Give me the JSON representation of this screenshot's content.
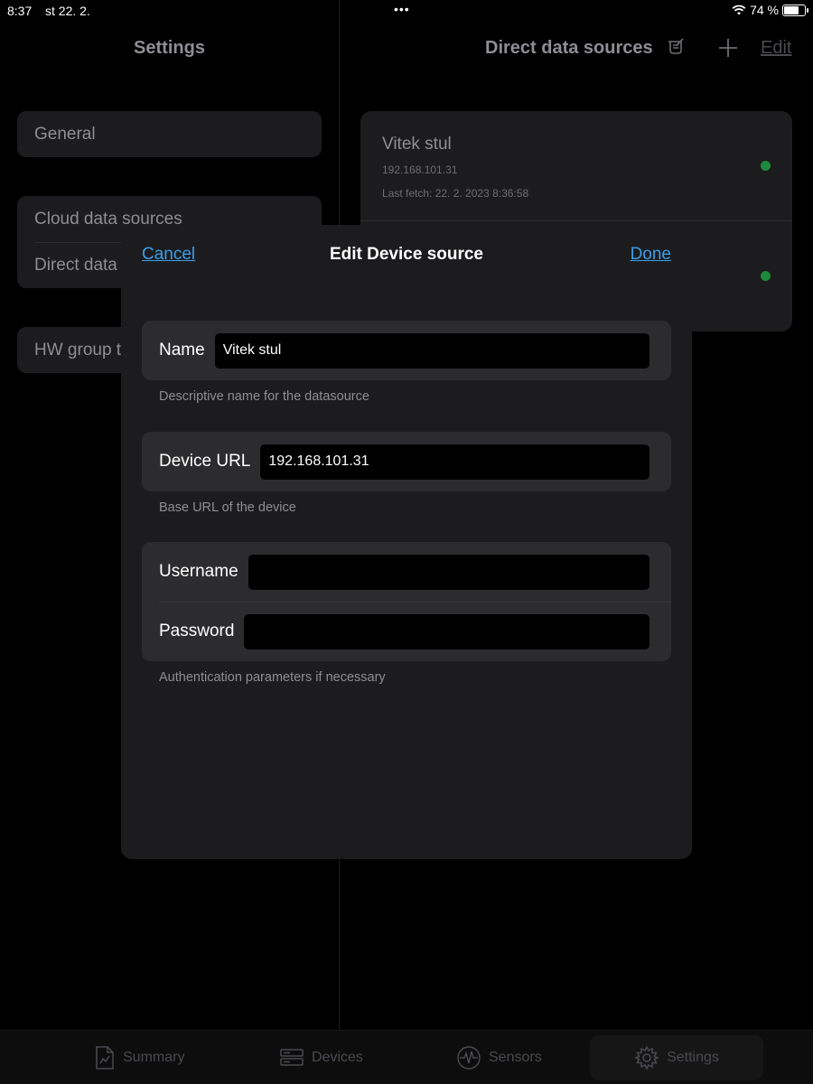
{
  "status_bar": {
    "time": "8:37",
    "date": "st 22. 2.",
    "dots": "•••",
    "battery": "74 %",
    "battery_level": 0.74
  },
  "left_panel": {
    "title": "Settings",
    "groups": [
      [
        "General"
      ],
      [
        "Cloud data sources",
        "Direct data"
      ],
      [
        "HW group t"
      ]
    ]
  },
  "right_panel": {
    "title": "Direct data sources",
    "icons": [
      "broom-icon",
      "plus-icon"
    ],
    "edit_label": "Edit",
    "sources": [
      {
        "name": "Vitek stul",
        "ip": "192.168.101.31",
        "last_fetch": "Last fetch:   22. 2. 2023 8:36:58",
        "status_color": "#1e8a3c"
      },
      {
        "name": "",
        "ip": "",
        "last_fetch": "",
        "status_color": "#1e8a3c"
      }
    ]
  },
  "modal": {
    "cancel_label": "Cancel",
    "title": "Edit Device source",
    "done_label": "Done",
    "name": {
      "label": "Name",
      "value": "Vitek stul",
      "note": "Descriptive name for the datasource"
    },
    "url": {
      "label": "Device URL",
      "value": "192.168.101.31",
      "note": "Base URL of the device"
    },
    "auth": {
      "username_label": "Username",
      "username_value": "",
      "password_label": "Password",
      "password_value": "",
      "note": "Authentication parameters if necessary"
    }
  },
  "tab_bar": {
    "tabs": [
      {
        "label": "Summary",
        "icon": "document-chart-icon"
      },
      {
        "label": "Devices",
        "icon": "server-icon"
      },
      {
        "label": "Sensors",
        "icon": "waveform-icon"
      },
      {
        "label": "Settings",
        "icon": "gear-icon",
        "selected": true
      }
    ]
  },
  "colors": {
    "accent": "#3a9ee8",
    "status_ok": "#1e8a3c",
    "background": "#000000",
    "panel": "#1c1c1e"
  }
}
